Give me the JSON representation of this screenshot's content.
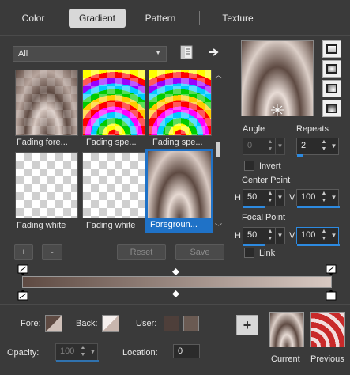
{
  "tabs": [
    {
      "label": "Color",
      "active": false
    },
    {
      "label": "Gradient",
      "active": true
    },
    {
      "label": "Pattern",
      "active": false
    },
    {
      "label": "Texture",
      "active": false
    }
  ],
  "category": {
    "value": "All"
  },
  "thumbnails": [
    {
      "caption": "Fading fore..."
    },
    {
      "caption": "Fading spe..."
    },
    {
      "caption": "Fading spe..."
    },
    {
      "caption": "Fading white"
    },
    {
      "caption": "Fading white"
    },
    {
      "caption": "Foregroun...",
      "selected": true
    }
  ],
  "list_buttons": {
    "add": "+",
    "remove": "-",
    "reset": "Reset",
    "save": "Save"
  },
  "angle": {
    "label": "Angle",
    "value": "0"
  },
  "repeats": {
    "label": "Repeats",
    "value": "2"
  },
  "invert": {
    "label": "Invert",
    "checked": false
  },
  "center_point": {
    "label": "Center Point",
    "h_label": "H",
    "h": "50",
    "v_label": "V",
    "v": "100"
  },
  "focal_point": {
    "label": "Focal Point",
    "h_label": "H",
    "h": "50",
    "v_label": "V",
    "v": "100"
  },
  "link": {
    "label": "Link",
    "checked": false
  },
  "bottom": {
    "fore_label": "Fore:",
    "back_label": "Back:",
    "user_label": "User:",
    "opacity_label": "Opacity:",
    "opacity": "100",
    "location_label": "Location:",
    "location": "0"
  },
  "current": {
    "label": "Current"
  },
  "previous": {
    "label": "Previous"
  },
  "colors": {
    "gradient_dark": "#5e4a42",
    "gradient_light": "#d8c9c2",
    "accent": "#2d8ae0"
  }
}
